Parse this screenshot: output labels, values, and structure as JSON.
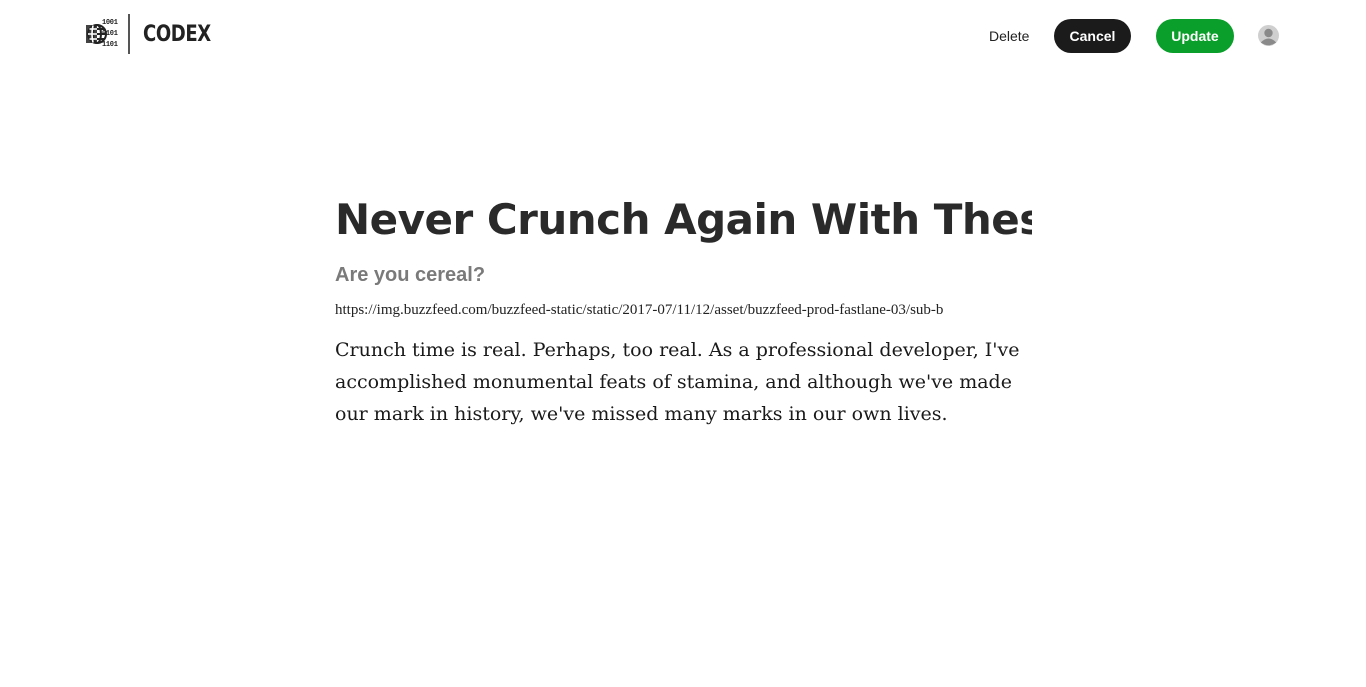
{
  "brand": {
    "logo_digits": [
      "1001",
      "0101",
      "1101"
    ],
    "name": "CODEX"
  },
  "toolbar": {
    "delete_label": "Delete",
    "cancel_label": "Cancel",
    "update_label": "Update"
  },
  "colors": {
    "cancel_bg": "#1b1b1b",
    "update_bg": "#0a9e2a",
    "subtitle": "#7a7a7a"
  },
  "post": {
    "title": "Never Crunch Again With These Fi",
    "subtitle": "Are you cereal?",
    "image_url": "https://img.buzzfeed.com/buzzfeed-static/static/2017-07/11/12/asset/buzzfeed-prod-fastlane-03/sub-b",
    "body": "Crunch time is real. Perhaps, too real. As a professional developer, I've accomplished monumental feats of stamina, and although we've made our mark in history, we've missed many marks in our own lives."
  },
  "icons": {
    "avatar": "user-avatar-icon",
    "logo": "globe-icon"
  }
}
